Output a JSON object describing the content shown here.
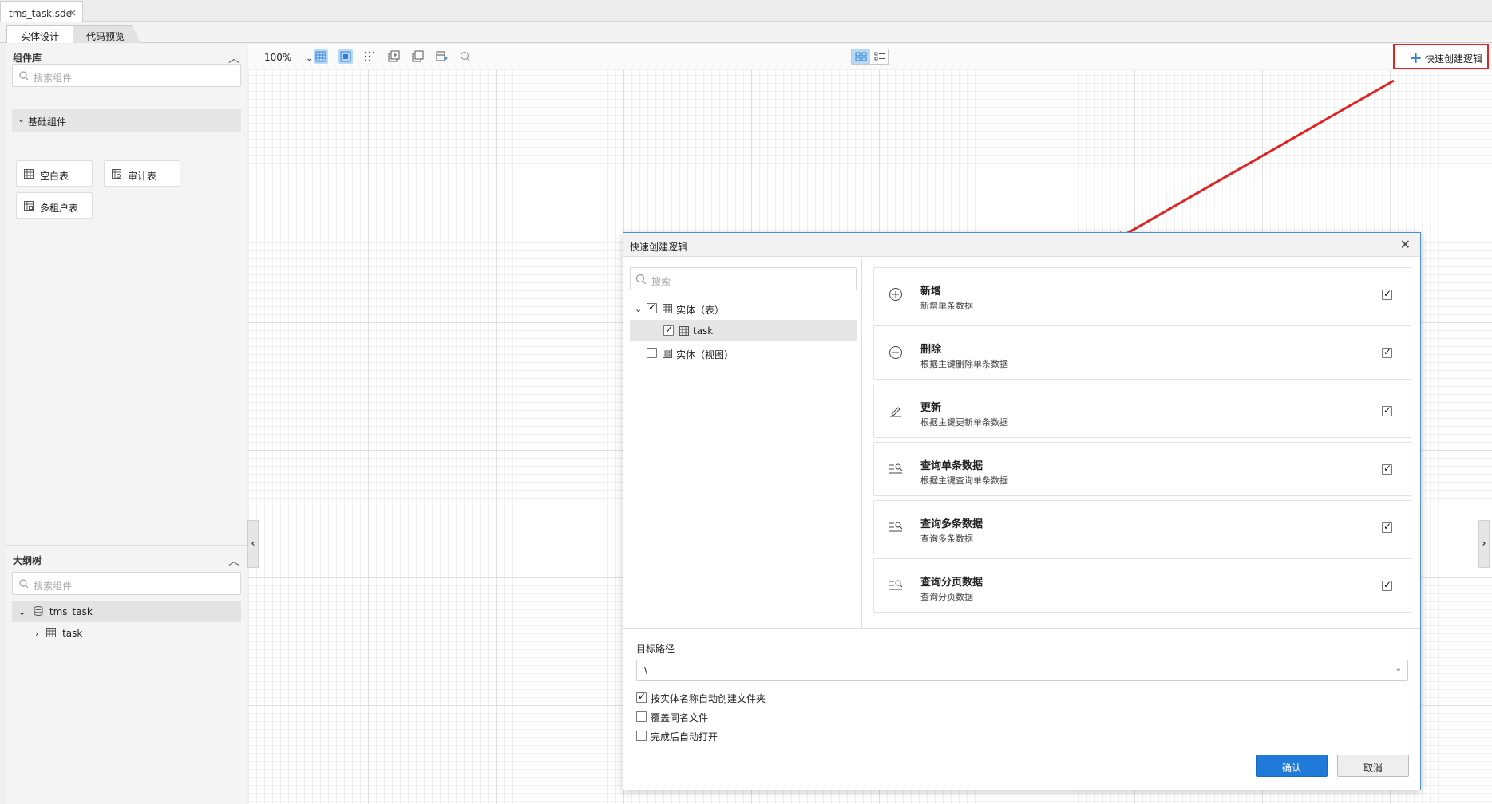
{
  "file_tab": {
    "name": "tms_task.sde",
    "close": "×"
  },
  "view_tabs": [
    {
      "label": "实体设计"
    },
    {
      "label": "代码预览"
    }
  ],
  "component_panel": {
    "title": "组件库",
    "search_placeholder": "搜索组件",
    "group": "基础组件",
    "components": [
      {
        "label": "空白表"
      },
      {
        "label": "审计表"
      },
      {
        "label": "多租户表"
      }
    ]
  },
  "outline_panel": {
    "title": "大纲树",
    "search_placeholder": "搜索组件",
    "tree": [
      {
        "label": "tms_task"
      },
      {
        "label": "task"
      }
    ]
  },
  "toolbar": {
    "zoom": "100%",
    "quick_create_label": "快速创建逻辑",
    "quick_create_icon": "plus-icon"
  },
  "dialog": {
    "title": "快速创建逻辑",
    "search_placeholder": "搜索",
    "tree": [
      {
        "label": "实体（表）",
        "checked": true
      },
      {
        "label": "task",
        "checked": true
      },
      {
        "label": "实体（视图）",
        "checked": false
      }
    ],
    "operations": [
      {
        "title": "新增",
        "desc": "新增单条数据",
        "icon": "plus-circle-icon",
        "checked": true
      },
      {
        "title": "删除",
        "desc": "根据主键删除单条数据",
        "icon": "minus-circle-icon",
        "checked": true
      },
      {
        "title": "更新",
        "desc": "根据主键更新单条数据",
        "icon": "edit-icon",
        "checked": true
      },
      {
        "title": "查询单条数据",
        "desc": "根据主键查询单条数据",
        "icon": "search-list-icon",
        "checked": true
      },
      {
        "title": "查询多条数据",
        "desc": "查询多条数据",
        "icon": "search-list-icon",
        "checked": true
      },
      {
        "title": "查询分页数据",
        "desc": "查询分页数据",
        "icon": "search-list-icon",
        "checked": true
      }
    ],
    "target_path_label": "目标路径",
    "target_path_value": "\\",
    "options": [
      {
        "label": "按实体名称自动创建文件夹",
        "checked": true
      },
      {
        "label": "覆盖同名文件",
        "checked": false
      },
      {
        "label": "完成后自动打开",
        "checked": false
      }
    ],
    "confirm_label": "确认",
    "cancel_label": "取消"
  },
  "colors": {
    "accent": "#1f7ad9",
    "highlight_border": "#e02424",
    "dialog_border": "#4b8fd6"
  }
}
